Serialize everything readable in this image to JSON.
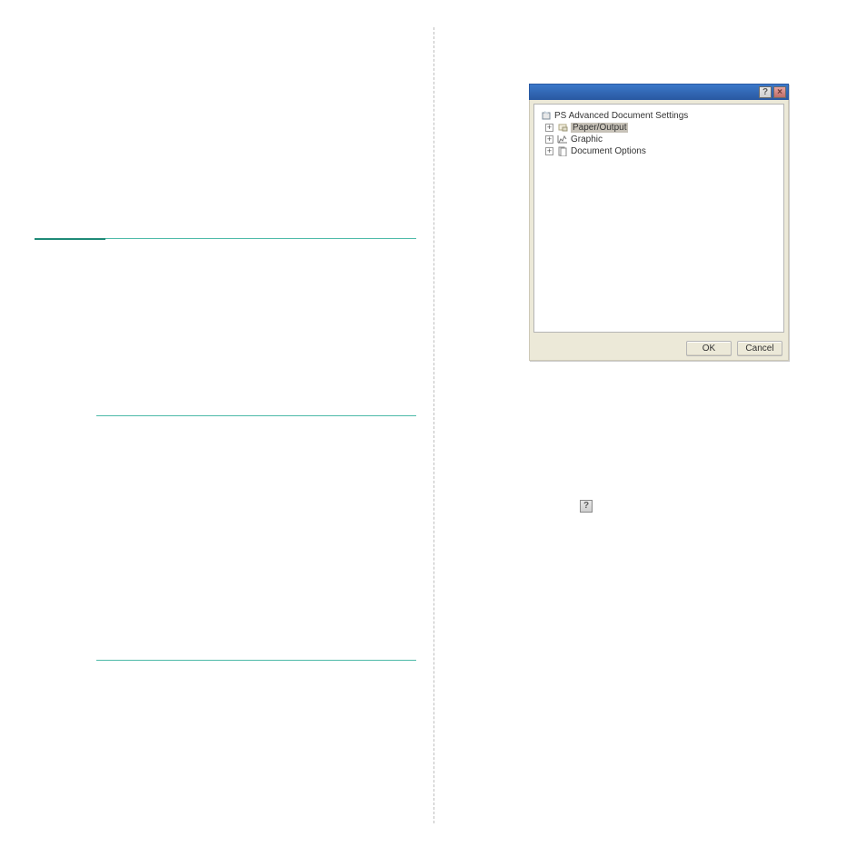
{
  "dialog": {
    "title": "",
    "help_btn": "?",
    "close_btn": "×",
    "tree": {
      "root": "PS Advanced Document Settings",
      "items": [
        "Paper/Output",
        "Graphic",
        "Document Options"
      ]
    },
    "ok_label": "OK",
    "cancel_label": "Cancel"
  },
  "inline_help_icon": "?"
}
